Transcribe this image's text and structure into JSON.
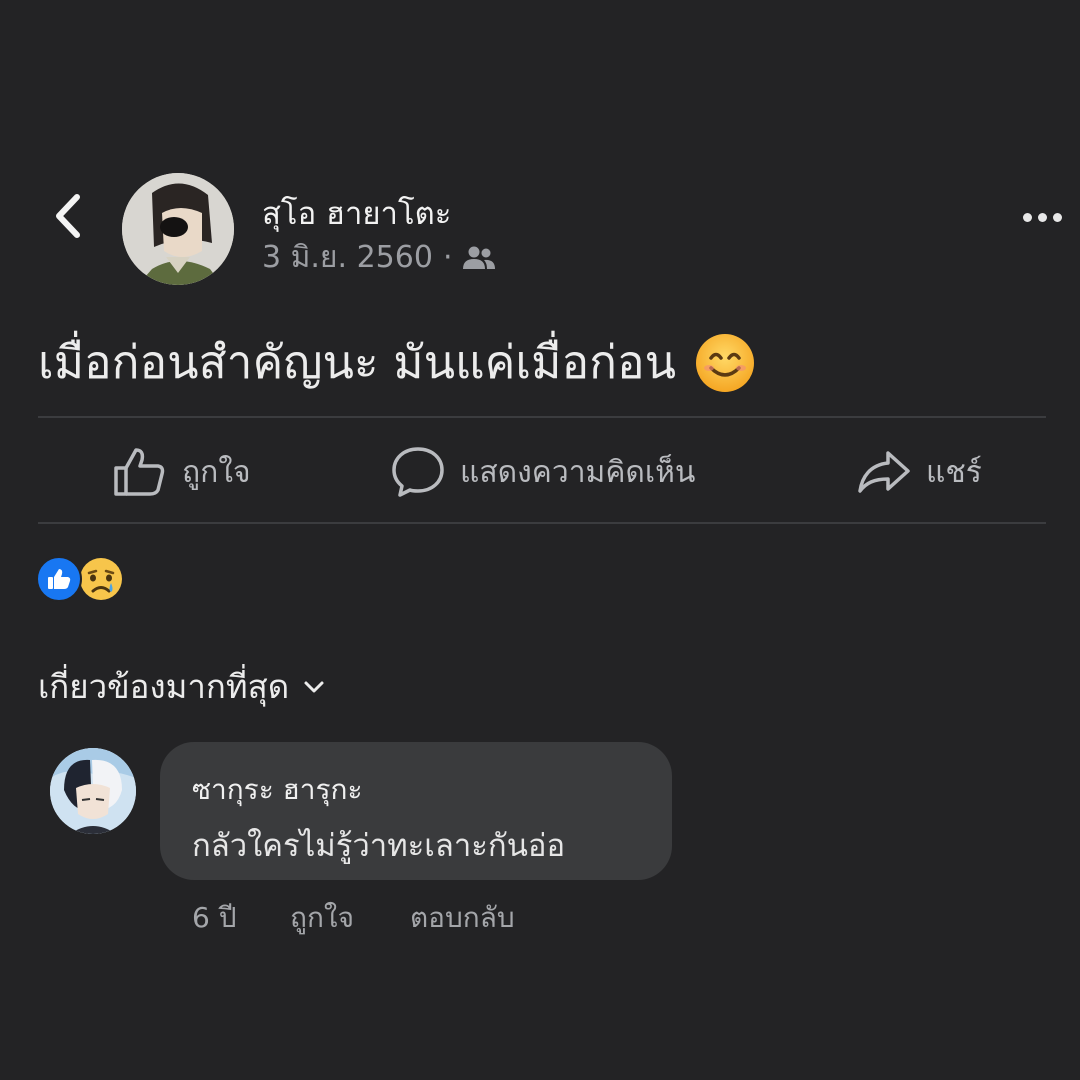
{
  "header": {
    "author_name": "สุโอ ฮายาโตะ",
    "date": "3 มิ.ย. 2560",
    "separator": "·",
    "audience_icon": "friends-icon"
  },
  "post": {
    "text": "เมื่อก่อนสำคัญนะ มันแค่เมื่อก่อน",
    "emoji_icon": "smiling-face-icon"
  },
  "actions": {
    "like_label": "ถูกใจ",
    "comment_label": "แสดงความคิดเห็น",
    "share_label": "แชร์"
  },
  "reactions": [
    "like",
    "sad"
  ],
  "comments_section": {
    "sort_label": "เกี่ยวข้องมากที่สุด"
  },
  "comments": [
    {
      "author": "ซากุระ ฮารุกะ",
      "text": "กลัวใครไม่รู้ว่าทะเลาะกันอ่อ",
      "time": "6 ปี",
      "like_label": "ถูกใจ",
      "reply_label": "ตอบกลับ"
    }
  ],
  "colors": {
    "background": "#232325",
    "bubble": "#3a3b3d",
    "like_blue": "#1877f2",
    "muted_text": "#9c9ea3"
  }
}
